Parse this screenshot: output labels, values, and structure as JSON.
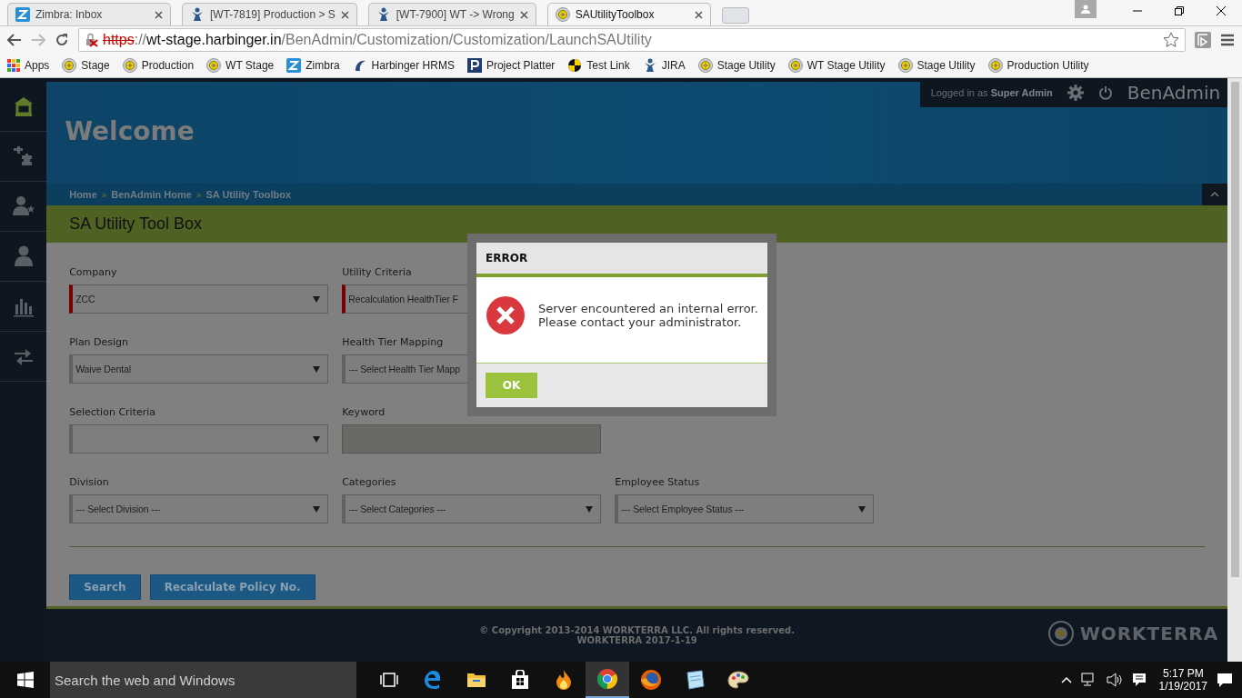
{
  "browser": {
    "tabs": [
      {
        "title": "Zimbra: Inbox",
        "kind": "zimbra",
        "selected": false
      },
      {
        "title": "[WT-7819] Production > S",
        "kind": "jira",
        "selected": false
      },
      {
        "title": "[WT-7900] WT -> Wrong",
        "kind": "jira",
        "selected": false
      },
      {
        "title": "SAUtilityToolbox",
        "kind": "site",
        "selected": true
      }
    ],
    "address": {
      "scheme": "https",
      "separator": "://",
      "host": "wt-stage.harbinger.in",
      "path": "/BenAdmin/Customization/Customization/LaunchSAUtility"
    },
    "bookmarks": [
      {
        "label": "Apps",
        "kind": "apps"
      },
      {
        "label": "Stage",
        "kind": "site"
      },
      {
        "label": "Production",
        "kind": "site"
      },
      {
        "label": "WT Stage",
        "kind": "site"
      },
      {
        "label": "Zimbra",
        "kind": "zimbra"
      },
      {
        "label": "Harbinger HRMS",
        "kind": "hrms"
      },
      {
        "label": "Project Platter",
        "kind": "platter"
      },
      {
        "label": "Test Link",
        "kind": "testlink"
      },
      {
        "label": "JIRA",
        "kind": "jira"
      },
      {
        "label": "Stage Utility",
        "kind": "site"
      },
      {
        "label": "WT Stage Utility",
        "kind": "site"
      },
      {
        "label": "Stage Utility",
        "kind": "site"
      },
      {
        "label": "Production Utility",
        "kind": "site"
      }
    ]
  },
  "sidebar": {
    "items": [
      {
        "kind": "home",
        "selected": true
      },
      {
        "kind": "puzzle",
        "selected": false
      },
      {
        "kind": "user-star",
        "selected": false
      },
      {
        "kind": "user",
        "selected": false
      },
      {
        "kind": "chart",
        "selected": false
      },
      {
        "kind": "transfer",
        "selected": false
      }
    ]
  },
  "header": {
    "logged_in": "Logged in as **Super Admin**",
    "app_name": "BenAdmin",
    "welcome": "Welcome",
    "breadcrumb": [
      "Home",
      "BenAdmin Home",
      "SA Utility Toolbox"
    ],
    "breadcrumb_separator": "»"
  },
  "page_title": "SA Utility Tool Box",
  "form": {
    "rows": [
      [
        {
          "label": "Company",
          "kind": "select",
          "value": "ZCC",
          "required": true,
          "disabled": false
        },
        {
          "label": "Utility Criteria",
          "kind": "select",
          "value": "Recalculation HealthTier F",
          "required": true,
          "disabled": false
        }
      ],
      [
        {
          "label": "Plan Design",
          "kind": "select",
          "value": "Waive Dental",
          "required": false,
          "disabled": false
        },
        {
          "label": "Health Tier Mapping",
          "kind": "select",
          "value": "--- Select Health Tier Mapp",
          "required": false,
          "disabled": false
        }
      ],
      [
        {
          "label": "Selection Criteria",
          "kind": "select",
          "required": false,
          "disabled": false
        },
        {
          "label": "Keyword",
          "kind": "input",
          "required": false,
          "disabled": true
        }
      ],
      [
        {
          "label": "Division",
          "kind": "select",
          "value": "--- Select Division ---",
          "required": false,
          "disabled": false
        },
        {
          "label": "Categories",
          "kind": "select",
          "value": "--- Select Categories ---",
          "required": false,
          "disabled": false
        },
        {
          "label": "Employee Status",
          "kind": "select",
          "value": "--- Select Employee Status ---",
          "required": false,
          "disabled": false
        }
      ]
    ],
    "buttons": [
      "Search",
      "Recalculate Policy No."
    ]
  },
  "footer": {
    "copyright": "© Copyright 2013-2014 WORKTERRA LLC. All rights reserved.",
    "version": "WORKTERRA 2017-1-19",
    "logo": "WORKTERRA"
  },
  "dialog": {
    "title": "ERROR",
    "message_lines": [
      "Server encountered an internal error.",
      "Please contact your administrator."
    ],
    "button": "OK"
  },
  "taskbar": {
    "search_placeholder": "Search the web and Windows",
    "apps": [
      {
        "kind": "task-view",
        "selected": false
      },
      {
        "kind": "edge",
        "selected": false
      },
      {
        "kind": "folder",
        "selected": false
      },
      {
        "kind": "store",
        "selected": false
      },
      {
        "kind": "flame",
        "selected": false
      },
      {
        "kind": "chrome",
        "selected": true
      },
      {
        "kind": "firefox",
        "selected": false
      },
      {
        "kind": "notepad",
        "selected": false
      },
      {
        "kind": "paint",
        "selected": false
      }
    ],
    "time": "5:17 PM",
    "date": "1/19/2017"
  }
}
